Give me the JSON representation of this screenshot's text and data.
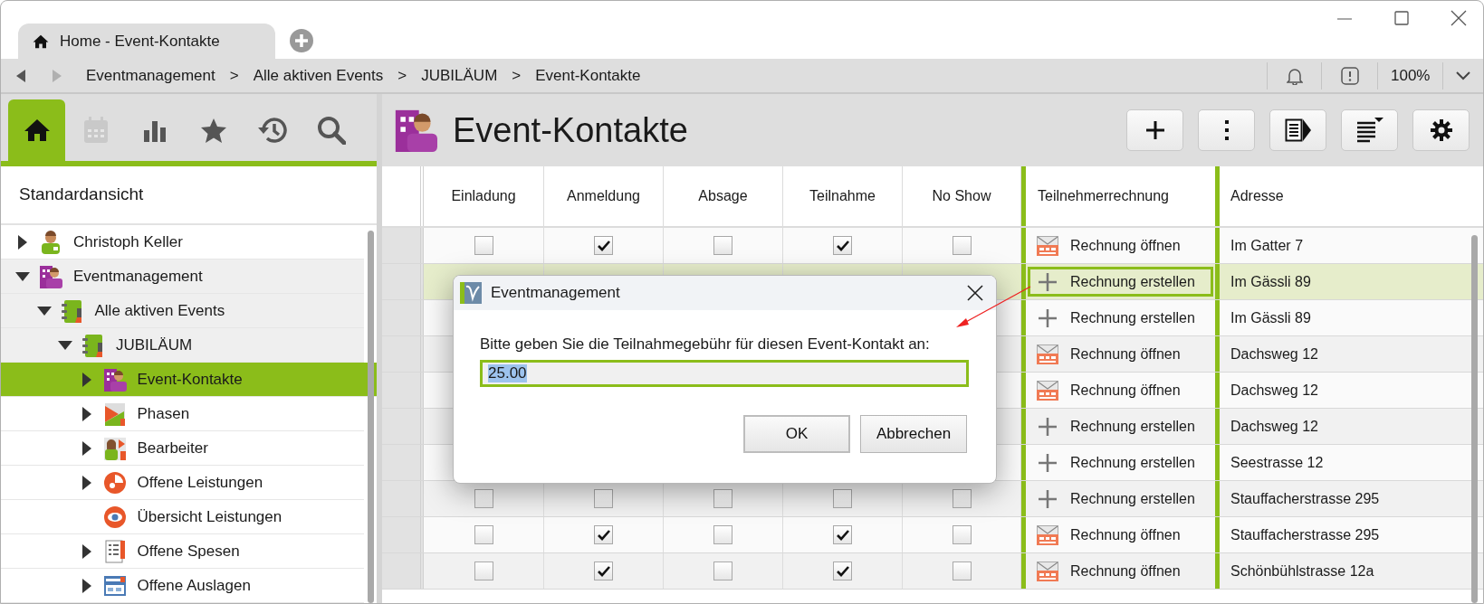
{
  "window": {
    "tab_title": "Home - Event-Kontakte"
  },
  "navigation": [
    {
      "kind": "back",
      "disabled": false
    },
    {
      "kind": "forward",
      "disabled": true
    }
  ],
  "breadcrumb": {
    "separator": ">",
    "items": [
      "Eventmanagement",
      "Alle aktiven Events",
      "JUBILÄUM",
      "Event-Kontakte"
    ]
  },
  "zoom": "100%",
  "sidebar": {
    "tabs": [
      {
        "kind": "home",
        "selected": true,
        "disabled": false
      },
      {
        "kind": "calendar",
        "selected": false,
        "disabled": true
      },
      {
        "kind": "chart",
        "selected": false,
        "disabled": false
      },
      {
        "kind": "star",
        "selected": false,
        "disabled": false
      },
      {
        "kind": "history",
        "selected": false,
        "disabled": false
      },
      {
        "kind": "search",
        "selected": false,
        "disabled": false
      }
    ],
    "view_title": "Standardansicht",
    "tree": [
      {
        "label": "Christoph Keller",
        "kind": "person",
        "expandable": true,
        "expanded": false,
        "selected": false
      },
      {
        "label": "Eventmanagement",
        "kind": "org",
        "expandable": true,
        "expanded": true,
        "selected": false,
        "children": [
          {
            "label": "Alle aktiven Events",
            "kind": "binder",
            "expandable": true,
            "expanded": true,
            "selected": false,
            "children": [
              {
                "label": "JUBILÄUM",
                "kind": "binder",
                "expandable": true,
                "expanded": true,
                "selected": false,
                "children": [
                  {
                    "label": "Event-Kontakte",
                    "kind": "org",
                    "expandable": true,
                    "expanded": false,
                    "selected": true
                  },
                  {
                    "label": "Phasen",
                    "kind": "phase",
                    "expandable": true,
                    "expanded": false,
                    "selected": false
                  },
                  {
                    "label": "Bearbeiter",
                    "kind": "team",
                    "expandable": true,
                    "expanded": false,
                    "selected": false
                  },
                  {
                    "label": "Offene Leistungen",
                    "kind": "pie",
                    "expandable": true,
                    "expanded": false,
                    "selected": false
                  },
                  {
                    "label": "Übersicht Leistungen",
                    "kind": "eye",
                    "expandable": false,
                    "selected": false
                  },
                  {
                    "label": "Offene Spesen",
                    "kind": "receipt",
                    "expandable": true,
                    "expanded": false,
                    "selected": false
                  },
                  {
                    "label": "Offene Auslagen",
                    "kind": "form",
                    "expandable": true,
                    "expanded": false,
                    "selected": false
                  }
                ]
              }
            ]
          }
        ]
      }
    ]
  },
  "page": {
    "title": "Event-Kontakte",
    "toolbar": [
      {
        "kind": "add"
      },
      {
        "kind": "more"
      },
      {
        "kind": "details"
      },
      {
        "kind": "columns"
      },
      {
        "kind": "settings"
      }
    ]
  },
  "table": {
    "columns": [
      "Einladung",
      "Anmeldung",
      "Absage",
      "Teilnahme",
      "No Show",
      "Teilnehmerrechnung",
      "Adresse"
    ],
    "rows": [
      {
        "selected": false,
        "checks": [
          false,
          true,
          false,
          true,
          false
        ],
        "invoice": {
          "kind": "open",
          "label": "Rechnung öffnen"
        },
        "address": "Im Gatter 7"
      },
      {
        "selected": true,
        "invoice": {
          "kind": "create",
          "label": "Rechnung erstellen"
        },
        "address": "Im Gässli 89"
      },
      {
        "selected": false,
        "invoice": {
          "kind": "create",
          "label": "Rechnung erstellen"
        },
        "address": "Im Gässli 89"
      },
      {
        "selected": false,
        "invoice": {
          "kind": "open",
          "label": "Rechnung öffnen"
        },
        "address": "Dachsweg 12"
      },
      {
        "selected": false,
        "invoice": {
          "kind": "open",
          "label": "Rechnung öffnen"
        },
        "address": "Dachsweg 12"
      },
      {
        "selected": false,
        "invoice": {
          "kind": "create",
          "label": "Rechnung erstellen"
        },
        "address": "Dachsweg 12"
      },
      {
        "selected": false,
        "invoice": {
          "kind": "create",
          "label": "Rechnung erstellen"
        },
        "address": "Seestrasse 12"
      },
      {
        "selected": false,
        "checks": [
          false,
          false,
          false,
          false,
          false
        ],
        "invoice": {
          "kind": "create",
          "label": "Rechnung erstellen"
        },
        "address": "Stauffacherstrasse 295"
      },
      {
        "selected": false,
        "checks": [
          false,
          true,
          false,
          true,
          false
        ],
        "invoice": {
          "kind": "open",
          "label": "Rechnung öffnen"
        },
        "address": "Stauffacherstrasse 295"
      },
      {
        "selected": false,
        "checks": [
          false,
          true,
          false,
          true,
          false
        ],
        "invoice": {
          "kind": "open",
          "label": "Rechnung öffnen"
        },
        "address": "Schönbühlstrasse 12a"
      }
    ]
  },
  "dialog": {
    "title": "Eventmanagement",
    "prompt": "Bitte geben Sie die Teilnahmegebühr für diesen Event-Kontakt an:",
    "value": "25.00",
    "value_selected": true,
    "buttons": [
      {
        "label": "OK",
        "default": true
      },
      {
        "label": "Abbrechen",
        "default": false
      }
    ]
  }
}
